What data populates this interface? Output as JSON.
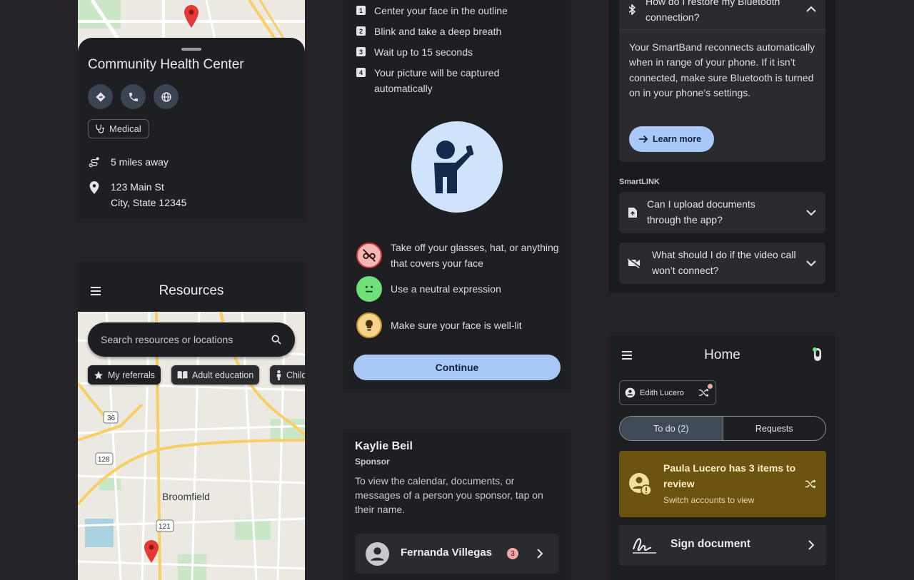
{
  "place_card": {
    "title": "Community Health Center",
    "actions": [
      {
        "icon": "directions-icon"
      },
      {
        "icon": "phone-icon"
      },
      {
        "icon": "globe-icon"
      }
    ],
    "category_chip": "Medical",
    "distance": "5 miles away",
    "address_line1": "123 Main St",
    "address_line2": "City, State 12345"
  },
  "resources": {
    "title": "Resources",
    "search_placeholder": "Search resources or locations",
    "chips": [
      "My referrals",
      "Adult education",
      "Child"
    ],
    "map_labels": {
      "city": "Broomfield",
      "routes": [
        "36",
        "128",
        "121"
      ]
    }
  },
  "face_capture": {
    "steps": [
      {
        "num": "1",
        "text": "Center your face in the outline"
      },
      {
        "num": "2",
        "text": "Blink and take a deep breath"
      },
      {
        "num": "3",
        "text": "Wait up to 15 seconds"
      },
      {
        "num": "4",
        "text": "Your picture will be captured automatically"
      }
    ],
    "tips": [
      {
        "text": "Take off your glasses, hat, or anything that covers your face",
        "color": "#f4b8b8"
      },
      {
        "text": "Use a neutral expression",
        "color": "#6ee07a"
      },
      {
        "text": "Make sure your face is well-lit",
        "color": "#f5d48a"
      }
    ],
    "continue_label": "Continue"
  },
  "sponsor": {
    "name": "Kaylie Beil",
    "role": "Sponsor",
    "description": "To view the calendar, documents, or messages of a person you sponsor, tap on their name.",
    "person": {
      "name": "Fernanda Villegas",
      "badge": "3"
    }
  },
  "faq": {
    "expanded_question": "How do I restore my Bluetooth connection?",
    "expanded_answer": "Your SmartBand reconnects automatically when in range of your phone. If it isn’t connected, make sure Bluetooth is turned on in your phone’s settings.",
    "learn_more": "Learn more",
    "section": "SmartLINK",
    "items": [
      {
        "q": "Can I upload documents through the app?",
        "icon": "upload-doc-icon"
      },
      {
        "q": "What should I do if the video call won’t connect?",
        "icon": "video-off-icon"
      }
    ]
  },
  "home": {
    "title": "Home",
    "account": "Edith Lucero",
    "tabs": [
      "To do (2)",
      "Requests"
    ],
    "alert_title": "Paula Lucero has 3 items to review",
    "alert_sub": "Switch accounts to view",
    "sign_label": "Sign document"
  },
  "colors": {
    "accent": "#a8c8f8",
    "alert_bg": "#6b5310",
    "surface": "#1e1f22",
    "background": "#25222a"
  }
}
